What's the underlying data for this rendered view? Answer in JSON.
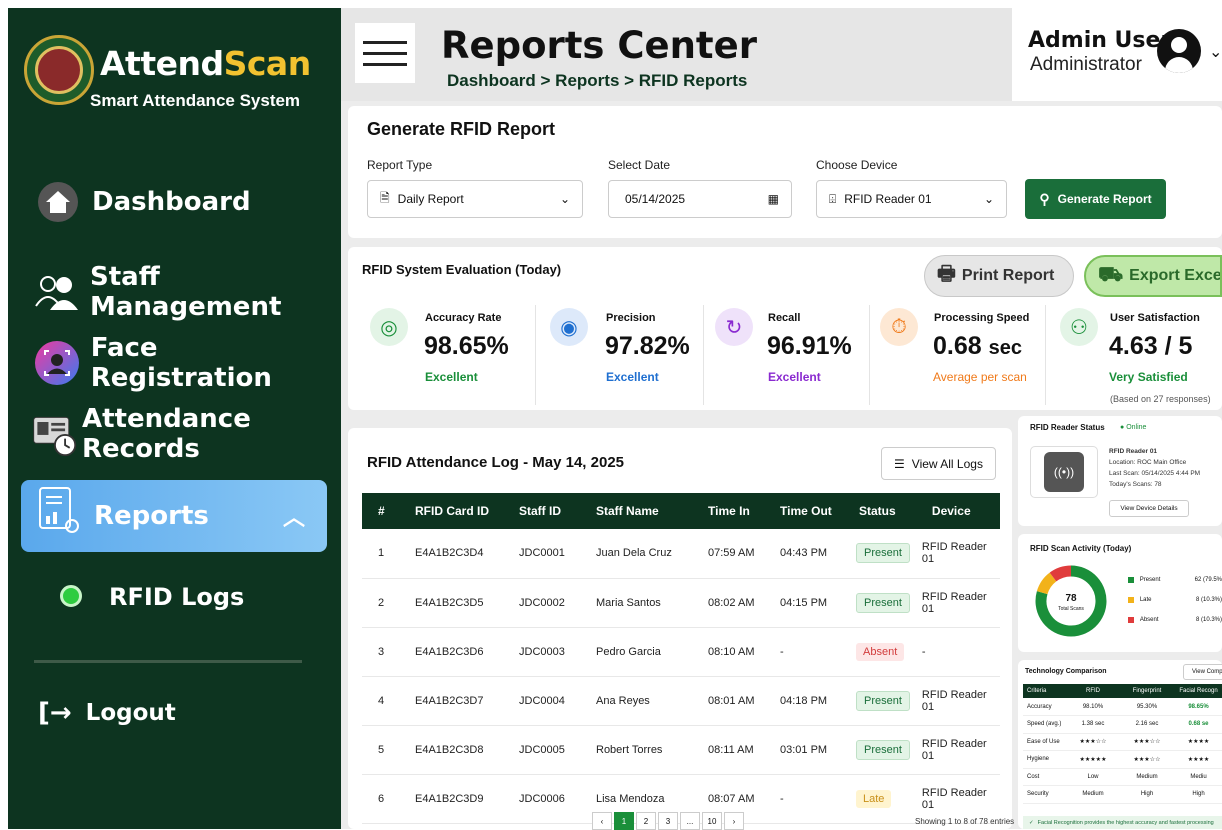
{
  "sidebar": {
    "brand_a": "Attend",
    "brand_b": "Scan",
    "tagline": "Smart Attendance System",
    "items": [
      {
        "label": "Dashboard"
      },
      {
        "label": "Staff Management"
      },
      {
        "label": "Face Registration"
      },
      {
        "label": "Attendance Records"
      },
      {
        "label": "Reports"
      }
    ],
    "subitem": "RFID Logs",
    "logout": "Logout"
  },
  "header": {
    "title": "Reports Center",
    "breadcrumb": "Dashboard > Reports > RFID Reports"
  },
  "user": {
    "name": "Admin User",
    "role": "Administrator"
  },
  "generate": {
    "title": "Generate RFID Report",
    "report_type_label": "Report Type",
    "report_type": "Daily Report",
    "date_label": "Select Date",
    "date": "05/14/2025",
    "device_label": "Choose Device",
    "device": "RFID Reader 01",
    "button": "Generate Report"
  },
  "evaluation": {
    "title": "RFID System Evaluation (Today)",
    "print": "Print Report",
    "export": "Export Exce",
    "metrics": [
      {
        "name": "Accuracy Rate",
        "value": "98.65%",
        "sub": "Excellent",
        "color": "#1a8f3a"
      },
      {
        "name": "Precision",
        "value": "97.82%",
        "sub": "Excellent",
        "color": "#1f6fd0"
      },
      {
        "name": "Recall",
        "value": "96.91%",
        "sub": "Excellent",
        "color": "#8a2ad0"
      },
      {
        "name": "Processing Speed",
        "value": "0.68",
        "unit": "sec",
        "sub": "Average per scan",
        "color": "#f07a1a"
      },
      {
        "name": "User Satisfaction",
        "value": "4.63 / 5",
        "sub": "Very Satisfied",
        "note": "(Based on 27 responses)",
        "color": "#1a8f3a"
      }
    ]
  },
  "log": {
    "title": "RFID Attendance Log - May 14, 2025",
    "view_all": "View All Logs",
    "columns": [
      "#",
      "RFID Card ID",
      "Staff ID",
      "Staff Name",
      "Time In",
      "Time Out",
      "Status",
      "Device"
    ],
    "rows": [
      [
        "1",
        "E4A1B2C3D4",
        "JDC0001",
        "Juan Dela Cruz",
        "07:59 AM",
        "04:43 PM",
        "Present",
        "RFID Reader 01"
      ],
      [
        "2",
        "E4A1B2C3D5",
        "JDC0002",
        "Maria Santos",
        "08:02 AM",
        "04:15 PM",
        "Present",
        "RFID Reader 01"
      ],
      [
        "3",
        "E4A1B2C3D6",
        "JDC0003",
        "Pedro Garcia",
        "08:10 AM",
        "-",
        "Absent",
        "-"
      ],
      [
        "4",
        "E4A1B2C3D7",
        "JDC0004",
        "Ana Reyes",
        "08:01 AM",
        "04:18 PM",
        "Present",
        "RFID Reader 01"
      ],
      [
        "5",
        "E4A1B2C3D8",
        "JDC0005",
        "Robert Torres",
        "08:11 AM",
        "03:01 PM",
        "Present",
        "RFID Reader 01"
      ],
      [
        "6",
        "E4A1B2C3D9",
        "JDC0006",
        "Lisa Mendoza",
        "08:07 AM",
        "-",
        "Late",
        "RFID Reader 01"
      ]
    ],
    "pages": [
      "‹",
      "1",
      "2",
      "3",
      "...",
      "10",
      "›"
    ],
    "showing": "Showing 1 to 8 of 78 entries"
  },
  "reader": {
    "title": "RFID Reader Status",
    "status": "Online",
    "name": "RFID Reader 01",
    "location": "Location: ROC Main Office",
    "last_scan": "Last Scan: 05/14/2025 4:44 PM",
    "today": "Today's Scans: 78",
    "button": "View Device Details"
  },
  "activity": {
    "title": "RFID Scan Activity (Today)",
    "total": "78",
    "total_label": "Total Scans",
    "legend": [
      {
        "label": "Present",
        "value": "62 (79.5%",
        "color": "#1a8f3a"
      },
      {
        "label": "Late",
        "value": "8 (10.3%)",
        "color": "#f2b21a"
      },
      {
        "label": "Absent",
        "value": "8 (10.3%)",
        "color": "#e03c3c"
      }
    ]
  },
  "chart_data": {
    "type": "pie",
    "categories": [
      "Present",
      "Late",
      "Absent"
    ],
    "values": [
      62,
      8,
      8
    ],
    "title": "RFID Scan Activity (Today)"
  },
  "tech": {
    "title": "Technology Comparison",
    "button": "View Comp",
    "columns": [
      "Criteria",
      "RFID",
      "Fingerprint",
      "Facial Recogn"
    ],
    "rows": [
      [
        "Accuracy",
        "98.10%",
        "95.30%",
        "98.65%"
      ],
      [
        "Speed (avg.)",
        "1.38 sec",
        "2.16 sec",
        "0.68 se"
      ],
      [
        "Ease of Use",
        "★★★☆☆",
        "★★★☆☆",
        "★★★★"
      ],
      [
        "Hygiene",
        "★★★★★",
        "★★★☆☆",
        "★★★★"
      ],
      [
        "Cost",
        "Low",
        "Medium",
        "Mediu"
      ],
      [
        "Security",
        "Medium",
        "High",
        "High"
      ]
    ],
    "footer": "Facial Recognition provides the highest accuracy and fastest processing"
  }
}
